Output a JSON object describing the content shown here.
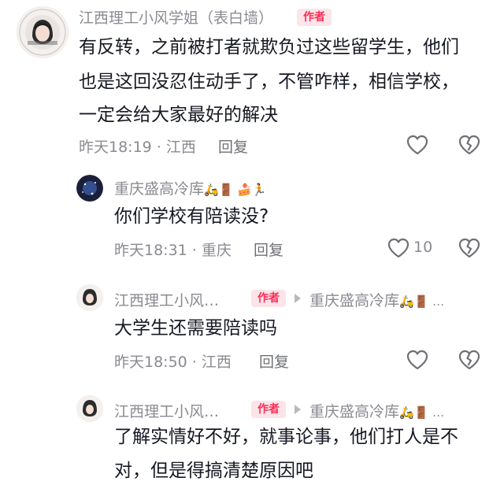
{
  "comments": [
    {
      "name": "江西理工小风学姐（表白墙）",
      "tag": "作者",
      "text_lines": [
        "有反转，之前被打者就欺负过这些留学生，他们",
        "也是这回没忍住动手了，不管咋样，相信学校，",
        "一定会给大家最好的解决"
      ],
      "time": "昨天18:19",
      "location": "江西",
      "reply_label": "回复"
    },
    {
      "name": "重庆盛高冷库",
      "name_emoji": "🛵🚪 🍰🏃",
      "text": "你们学校有陪读没?",
      "time": "昨天18:31",
      "location": "重庆",
      "reply_label": "回复",
      "like_count": "10"
    },
    {
      "name": "江西理工小风…",
      "tag": "作者",
      "reply_to": "重庆盛高冷库",
      "reply_to_emoji": "🛵🚪 …",
      "text": "大学生还需要陪读吗",
      "time": "昨天18:50",
      "location": "江西",
      "reply_label": "回复"
    },
    {
      "name": "江西理工小风…",
      "tag": "作者",
      "reply_to": "重庆盛高冷库",
      "reply_to_emoji": "🛵🚪 …",
      "text_lines": [
        "了解实情好不好，就事论事，他们打人是不",
        "对，但是得搞清楚原因吧"
      ]
    }
  ],
  "colors": {
    "author_tag_bg": "#fde4e9",
    "author_tag_text": "#fe2c55",
    "meta": "#8a8b91"
  },
  "icons": [
    "heart-outline-icon",
    "broken-heart-icon",
    "reply-arrow-icon"
  ]
}
